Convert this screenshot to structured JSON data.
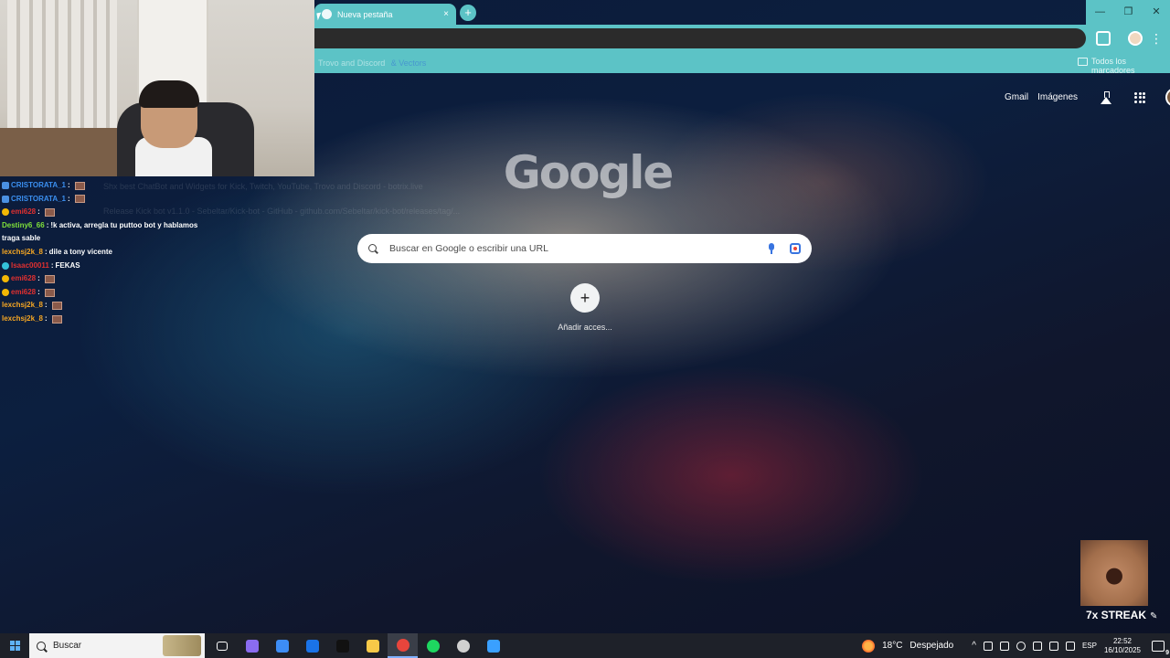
{
  "browser": {
    "tab_title": "Nueva pestaña",
    "new_tab_symbol": "+",
    "close_symbol": "×",
    "window_controls": [
      "—",
      "❐",
      "✕"
    ],
    "menu_symbol": "⋮",
    "bookmarks": {
      "left_item": "Trovo and Discord",
      "left_item_suffix": "& Vectors",
      "all_bookmarks": "Todos los marcadores"
    },
    "accent_color": "#5cc3c6"
  },
  "ntp": {
    "gmail": "Gmail",
    "images": "Imágenes",
    "logo_text": "Google",
    "search_placeholder": "Buscar en Google o escribir una URL",
    "shortcut_plus": "+",
    "shortcut_label": "Añadir acces..."
  },
  "ghost_text": {
    "line1": "Shx best ChatBot and Widgets for Kick, Twitch, YouTube, Trovo and Discord - botrix.live",
    "line2": "Release Kick bot v1.1.0 - Sebeltar/Kick-bot - GitHub - github.com/Sebeltar/kick-bot/releases/tag/..."
  },
  "chat": [
    {
      "user": "CRISTORATA_1",
      "color": "#3b8ff0",
      "badge": "b-blue",
      "text": "",
      "emote": true
    },
    {
      "user": "CRISTORATA_1",
      "color": "#3b8ff0",
      "badge": "b-blue",
      "text": "",
      "emote": true
    },
    {
      "user": "emi628",
      "color": "#e03030",
      "badge": "b-gold",
      "text": "",
      "emote": true
    },
    {
      "user": "Destiny6_66",
      "color": "#7fe03a",
      "badge": "",
      "text": "!k activa, arregla tu puttoo bot y hablamos traga sable",
      "emote": false,
      "wrap": true
    },
    {
      "user": "lexchsj2k_8",
      "color": "#f5a623",
      "badge": "",
      "text": "dile a tony vicente",
      "emote": false
    },
    {
      "user": "Isaac00011",
      "color": "#e03030",
      "badge": "b-cyan",
      "text": "FEKAS",
      "emote": false
    },
    {
      "user": "emi628",
      "color": "#e03030",
      "badge": "b-gold",
      "text": "",
      "emote": true
    },
    {
      "user": "emi628",
      "color": "#e03030",
      "badge": "b-gold",
      "text": "",
      "emote": true
    },
    {
      "user": "lexchsj2k_8",
      "color": "#f5a623",
      "badge": "",
      "text": "",
      "emote": true
    },
    {
      "user": "lexchsj2k_8",
      "color": "#f5a623",
      "badge": "",
      "text": "",
      "emote": true
    }
  ],
  "streak": {
    "label": "7x STREAK",
    "pencil": "✎"
  },
  "taskbar": {
    "search_label": "Buscar",
    "apps": [
      {
        "name": "task-view-icon",
        "color": "#ffffff"
      },
      {
        "name": "copilot-icon",
        "color": "#8a6cf0"
      },
      {
        "name": "store-icon",
        "color": "#3d8df5"
      },
      {
        "name": "outlook-icon",
        "color": "#1a73e8"
      },
      {
        "name": "tiktok-icon",
        "color": "#111111"
      },
      {
        "name": "file-explorer-icon",
        "color": "#f7c948"
      },
      {
        "name": "chrome-icon",
        "color": "#e8453c",
        "active": true
      },
      {
        "name": "spotify-icon",
        "color": "#1ed760"
      },
      {
        "name": "obs-icon",
        "color": "#d0d0d0"
      },
      {
        "name": "app-icon",
        "color": "#3aa0ff"
      }
    ],
    "weather_temp": "18°C",
    "weather_desc": "Despejado",
    "language": "ESP",
    "time": "22:52",
    "date": "16/10/2025",
    "notif_count": "9",
    "caret": "^"
  }
}
